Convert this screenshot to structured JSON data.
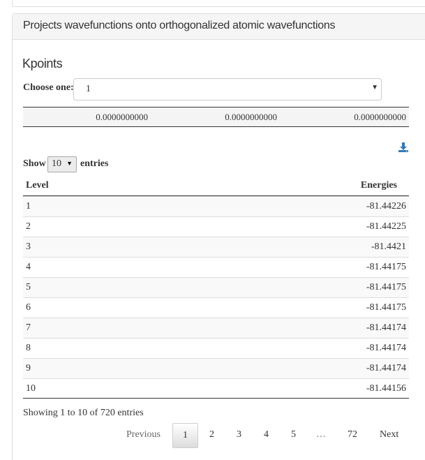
{
  "panel": {
    "title": "Projects wavefunctions onto orthogonalized atomic wavefunctions"
  },
  "kpoints": {
    "title": "Kpoints",
    "choose_label": "Choose one:",
    "selected": "1",
    "coords": [
      "0.0000000000",
      "0.0000000000",
      "0.0000000000"
    ]
  },
  "table_controls": {
    "show_label": "Show",
    "page_length": "10",
    "entries_label": "entries",
    "download_icon": "download-icon"
  },
  "table": {
    "headers": {
      "level": "Level",
      "energies": "Energies"
    },
    "rows": [
      {
        "level": "1",
        "energy": "-81.44226"
      },
      {
        "level": "2",
        "energy": "-81.44225"
      },
      {
        "level": "3",
        "energy": "-81.4421"
      },
      {
        "level": "4",
        "energy": "-81.44175"
      },
      {
        "level": "5",
        "energy": "-81.44175"
      },
      {
        "level": "6",
        "energy": "-81.44175"
      },
      {
        "level": "7",
        "energy": "-81.44174"
      },
      {
        "level": "8",
        "energy": "-81.44174"
      },
      {
        "level": "9",
        "energy": "-81.44174"
      },
      {
        "level": "10",
        "energy": "-81.44156"
      }
    ]
  },
  "info": "Showing 1 to 10 of 720 entries",
  "pagination": {
    "previous": "Previous",
    "current": "1",
    "pages": [
      "2",
      "3",
      "4",
      "5"
    ],
    "ellipsis": "…",
    "last": "72",
    "next": "Next"
  },
  "colors": {
    "download_icon": "#337ab7"
  }
}
